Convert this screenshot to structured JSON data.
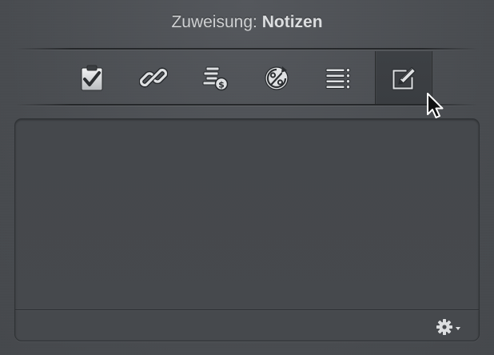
{
  "header": {
    "label": "Zuweisung",
    "separator": ":",
    "value": "Notizen"
  },
  "toolbar": {
    "tabs": [
      {
        "icon": "clipboard-check-icon",
        "name": "tab-task"
      },
      {
        "icon": "link-icon",
        "name": "tab-links"
      },
      {
        "icon": "coins-cost-icon",
        "name": "tab-cost"
      },
      {
        "icon": "percent-progress-icon",
        "name": "tab-progress"
      },
      {
        "icon": "list-icon",
        "name": "tab-list"
      },
      {
        "icon": "note-pencil-icon",
        "name": "tab-notes",
        "active": true
      }
    ]
  },
  "notes": {
    "text": ""
  },
  "footer": {
    "action_icon": "gear-dropdown-icon"
  },
  "colors": {
    "background": "#4a4d51",
    "panel": "#46494d",
    "icon": "#d8dadc",
    "title": "#d9dadc"
  }
}
